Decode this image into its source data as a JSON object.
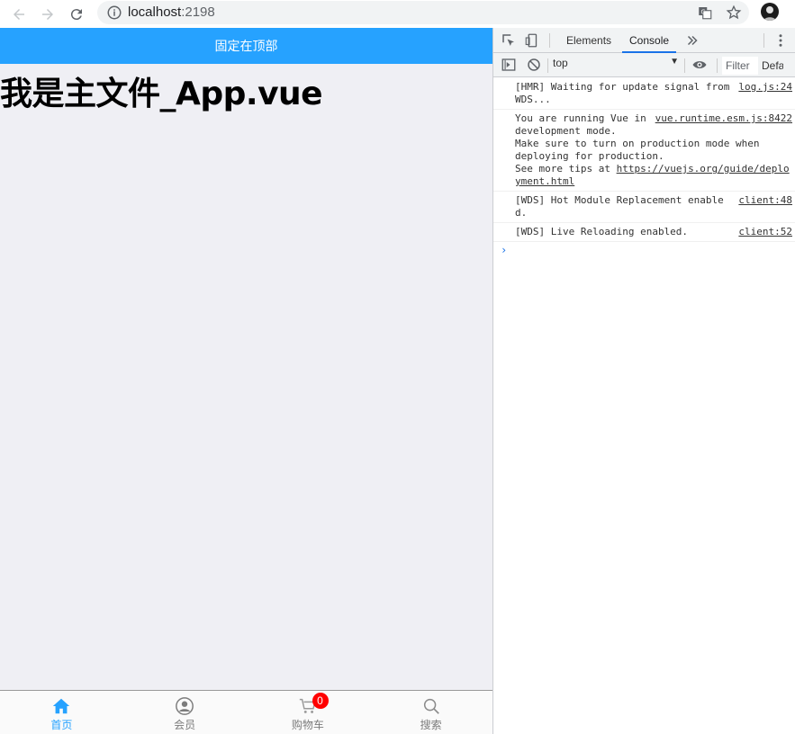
{
  "browser": {
    "url_host": "localhost",
    "url_port": ":2198"
  },
  "app": {
    "header_title": "固定在顶部",
    "heading": "我是主文件_App.vue",
    "tabbar": [
      {
        "label": "首页",
        "icon": "home-icon",
        "active": true
      },
      {
        "label": "会员",
        "icon": "user-icon",
        "active": false
      },
      {
        "label": "购物车",
        "icon": "cart-icon",
        "active": false,
        "badge": "0"
      },
      {
        "label": "搜索",
        "icon": "search-icon",
        "active": false
      }
    ],
    "colors": {
      "accent": "#26a2ff",
      "background": "#efeff4",
      "badge": "#ff0000"
    }
  },
  "devtools": {
    "tabs": [
      "Elements",
      "Console"
    ],
    "active_tab": "Console",
    "context": "top",
    "filter_placeholder": "Filter",
    "levels_label": "Default levels",
    "messages": [
      {
        "lines": [
          "[HMR] Waiting for update signal from",
          "WDS..."
        ],
        "source": "log.js:24"
      },
      {
        "lines": [
          "You are running Vue in",
          "development mode.",
          "Make sure to turn on production mode when",
          "deploying for production.",
          "See more tips at "
        ],
        "link": "https://vuejs.org/guide/deployment.html",
        "source": "vue.runtime.esm.js:8422"
      },
      {
        "lines": [
          "[WDS] Hot Module Replacement enabled."
        ],
        "source": "client:48"
      },
      {
        "lines": [
          "[WDS] Live Reloading enabled."
        ],
        "source": "client:52"
      }
    ],
    "prompt": "›"
  }
}
